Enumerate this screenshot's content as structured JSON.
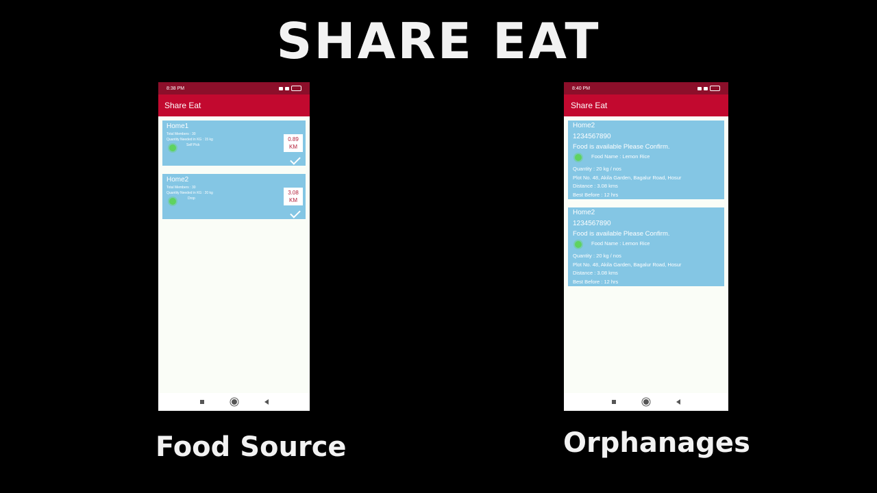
{
  "main_title": "SHARE EAT",
  "captions": {
    "left": "Food Source",
    "right": "Orphanages"
  },
  "left_phone": {
    "status_time": "8:38 PM",
    "app_title": "Share Eat",
    "cards": [
      {
        "title": "Home1",
        "members": "Total Members : 30",
        "quantity": "Quantity Needed in KG : 15 kg",
        "mode": "Self Pick",
        "distance_value": "0.89",
        "distance_unit": "KM"
      },
      {
        "title": "Home2",
        "members": "Total Members : 30",
        "quantity": "Quantity Needed in KG : 20 kg",
        "mode": "Drop",
        "distance_value": "3.08",
        "distance_unit": "KM"
      }
    ]
  },
  "right_phone": {
    "status_time": "8:40 PM",
    "app_title": "Share Eat",
    "cards": [
      {
        "title": "Home2",
        "phone": "1234567890",
        "message": "Food is available Please Confirm.",
        "food_name": "Food Name : Lemon Rice",
        "quantity": "Quantity : 20 kg / nos",
        "address": "Plot No. 48, Akila Garden, Bagalur Road, Hosur",
        "distance": "Distance : 3.08 kms",
        "best_before": "Best Before : 12 hrs"
      },
      {
        "title": "Home2",
        "phone": "1234567890",
        "message": "Food is available Please Confirm.",
        "food_name": "Food Name : Lemon Rice",
        "quantity": "Quantity : 20 kg / nos",
        "address": "Plot No. 48, Akila Garden, Bagalur Road, Hosur",
        "distance": "Distance : 3.08 kms",
        "best_before": "Best Before : 12 hrs"
      }
    ]
  },
  "icons": {
    "food": "green-food-icon",
    "confirm": "check-icon",
    "nav": [
      "recent-apps-icon",
      "home-icon",
      "back-icon"
    ]
  },
  "colors": {
    "app_bar": "#c2092f",
    "status_bar": "#8c0f2a",
    "card": "#84c6e4",
    "screen_bg": "#fafdf7",
    "distance_text": "#b3203a"
  }
}
